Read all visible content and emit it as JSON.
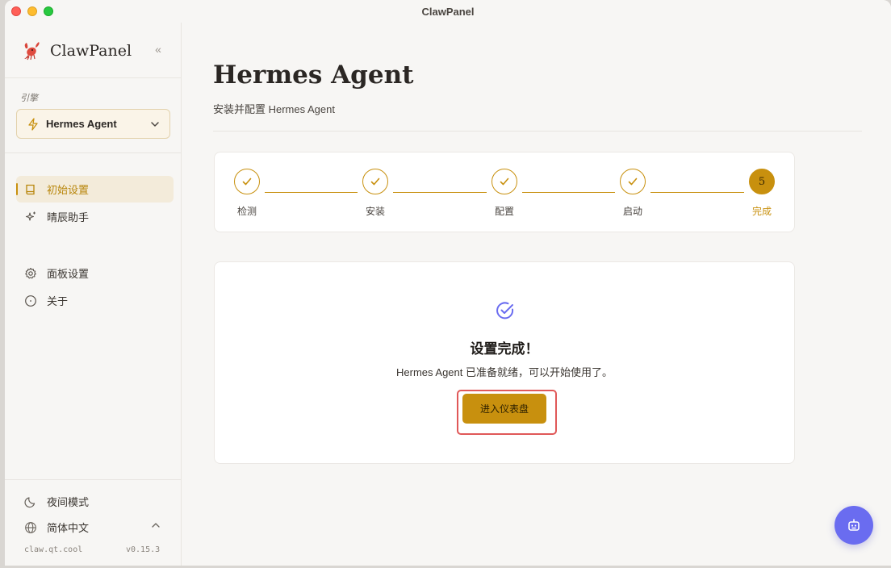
{
  "window": {
    "title": "ClawPanel"
  },
  "sidebar": {
    "brand_name": "ClawPanel",
    "collapse_label": "«",
    "engine_label": "引擎",
    "engine_value": "Hermes Agent",
    "nav_items": [
      {
        "label": "初始设置",
        "icon": "book-icon",
        "active": true
      },
      {
        "label": "晴辰助手",
        "icon": "sparkle-icon",
        "active": false
      }
    ],
    "settings_items": [
      {
        "label": "面板设置",
        "icon": "gear-icon"
      },
      {
        "label": "关于",
        "icon": "info-icon"
      }
    ],
    "footer": {
      "night_mode": "夜间模式",
      "language": "简体中文",
      "site": "claw.qt.cool",
      "version": "v0.15.3"
    }
  },
  "main": {
    "title": "Hermes Agent",
    "subtitle": "安装并配置 Hermes Agent",
    "steps": [
      {
        "label": "检测",
        "status": "done"
      },
      {
        "label": "安装",
        "status": "done"
      },
      {
        "label": "配置",
        "status": "done"
      },
      {
        "label": "启动",
        "status": "done"
      },
      {
        "label": "完成",
        "status": "current",
        "number": "5"
      }
    ],
    "result": {
      "title": "设置完成！",
      "description": "Hermes Agent 已准备就绪，可以开始使用了。",
      "button_label": "进入仪表盘"
    }
  },
  "colors": {
    "accent": "#c8900e",
    "highlight": "#e05858",
    "fab": "#6a6cf0"
  }
}
